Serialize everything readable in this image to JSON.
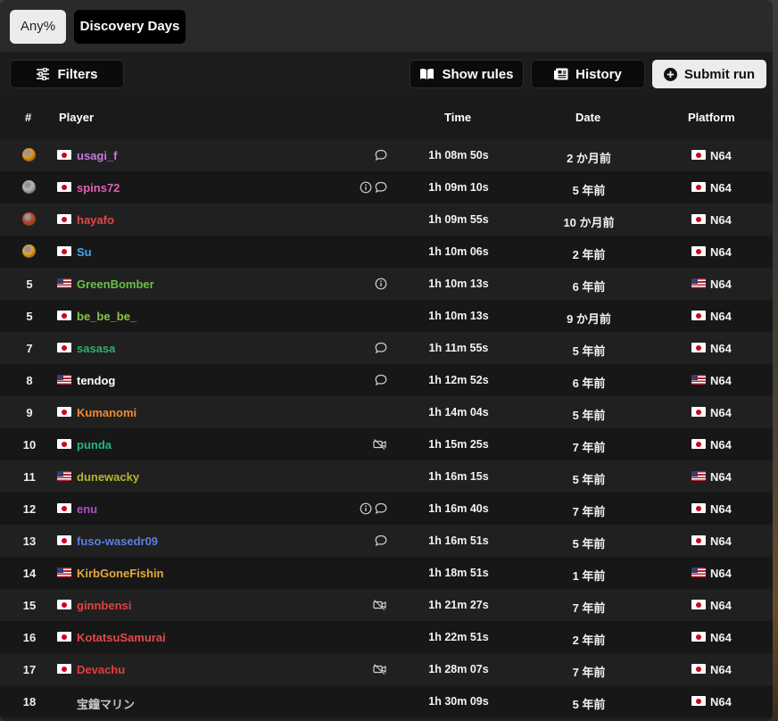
{
  "category_tabs": {
    "any_label": "Any%",
    "discovery_label": "Discovery Days"
  },
  "toolbar": {
    "filters_label": "Filters",
    "rules_label": "Show rules",
    "history_label": "History",
    "submit_label": "Submit run"
  },
  "table": {
    "headers": {
      "rank": "#",
      "player": "Player",
      "time": "Time",
      "date": "Date",
      "platform": "Platform"
    },
    "rows": [
      {
        "rank": "",
        "medal": "gold-trophy",
        "player_flag": "jp",
        "player": "usagi_f",
        "player_color": "#c678dd",
        "icons": [
          "comment"
        ],
        "time": "1h 08m 50s",
        "date": "2 か月前",
        "platform_flag": "jp",
        "platform": "N64"
      },
      {
        "rank": "",
        "medal": "silver-trophy",
        "player_flag": "jp",
        "player": "spins72",
        "player_color": "#e060b0",
        "icons": [
          "info",
          "comment"
        ],
        "time": "1h 09m 10s",
        "date": "5 年前",
        "platform_flag": "jp",
        "platform": "N64"
      },
      {
        "rank": "",
        "medal": "bronze-trophy",
        "player_flag": "jp",
        "player": "hayafo",
        "player_color": "#e04848",
        "icons": [],
        "time": "1h 09m 55s",
        "date": "10 か月前",
        "platform_flag": "jp",
        "platform": "N64"
      },
      {
        "rank": "",
        "medal": "fourth-trophy",
        "player_flag": "jp",
        "player": "Su",
        "player_color": "#4aa3e8",
        "icons": [],
        "time": "1h 10m 06s",
        "date": "2 年前",
        "platform_flag": "jp",
        "platform": "N64"
      },
      {
        "rank": "5",
        "medal": "",
        "player_flag": "us",
        "player": "GreenBomber",
        "player_color": "#6abf4b",
        "icons": [
          "info"
        ],
        "time": "1h 10m 13s",
        "date": "6 年前",
        "platform_flag": "us",
        "platform": "N64"
      },
      {
        "rank": "5",
        "medal": "",
        "player_flag": "jp",
        "player": "be_be_be_",
        "player_color": "#8bc34a",
        "icons": [],
        "time": "1h 10m 13s",
        "date": "9 か月前",
        "platform_flag": "jp",
        "platform": "N64"
      },
      {
        "rank": "7",
        "medal": "",
        "player_flag": "jp",
        "player": "sasasa",
        "player_color": "#28b463",
        "icons": [
          "comment"
        ],
        "time": "1h 11m 55s",
        "date": "5 年前",
        "platform_flag": "jp",
        "platform": "N64"
      },
      {
        "rank": "8",
        "medal": "",
        "player_flag": "us",
        "player": "tendog",
        "player_color": "#ffffff",
        "icons": [
          "comment"
        ],
        "time": "1h 12m 52s",
        "date": "6 年前",
        "platform_flag": "us",
        "platform": "N64"
      },
      {
        "rank": "9",
        "medal": "",
        "player_flag": "jp",
        "player": "Kumanomi",
        "player_color": "#f08a30",
        "icons": [],
        "time": "1h 14m 04s",
        "date": "5 年前",
        "platform_flag": "jp",
        "platform": "N64"
      },
      {
        "rank": "10",
        "medal": "",
        "player_flag": "jp",
        "player": "punda",
        "player_color": "#1fb87a",
        "icons": [
          "no-video"
        ],
        "time": "1h 15m 25s",
        "date": "7 年前",
        "platform_flag": "jp",
        "platform": "N64"
      },
      {
        "rank": "11",
        "medal": "",
        "player_flag": "us",
        "player": "dunewacky",
        "player_color": "#b5b531",
        "icons": [],
        "time": "1h 16m 15s",
        "date": "5 年前",
        "platform_flag": "us",
        "platform": "N64"
      },
      {
        "rank": "12",
        "medal": "",
        "player_flag": "jp",
        "player": "enu",
        "player_color": "#b04ccf",
        "icons": [
          "info",
          "comment"
        ],
        "time": "1h 16m 40s",
        "date": "7 年前",
        "platform_flag": "jp",
        "platform": "N64"
      },
      {
        "rank": "13",
        "medal": "",
        "player_flag": "jp",
        "player": "fuso-wasedr09",
        "player_color": "#5b7fe0",
        "icons": [
          "comment"
        ],
        "time": "1h 16m 51s",
        "date": "5 年前",
        "platform_flag": "jp",
        "platform": "N64"
      },
      {
        "rank": "14",
        "medal": "",
        "player_flag": "us",
        "player": "KirbGoneFishin",
        "player_color": "#e8a838",
        "icons": [],
        "time": "1h 18m 51s",
        "date": "1 年前",
        "platform_flag": "us",
        "platform": "N64"
      },
      {
        "rank": "15",
        "medal": "",
        "player_flag": "jp",
        "player": "ginnbensi",
        "player_color": "#e0443c",
        "icons": [
          "no-video"
        ],
        "time": "1h 21m 27s",
        "date": "7 年前",
        "platform_flag": "jp",
        "platform": "N64"
      },
      {
        "rank": "16",
        "medal": "",
        "player_flag": "jp",
        "player": "KotatsuSamurai",
        "player_color": "#e8464a",
        "icons": [],
        "time": "1h 22m 51s",
        "date": "2 年前",
        "platform_flag": "jp",
        "platform": "N64"
      },
      {
        "rank": "17",
        "medal": "",
        "player_flag": "jp",
        "player": "Devachu",
        "player_color": "#e83c3c",
        "icons": [
          "no-video"
        ],
        "time": "1h 28m 07s",
        "date": "7 年前",
        "platform_flag": "jp",
        "platform": "N64"
      },
      {
        "rank": "18",
        "medal": "",
        "player_flag": "",
        "player": "宝鐘マリン",
        "player_color": "#c8c8c8",
        "icons": [],
        "time": "1h 30m 09s",
        "date": "5 年前",
        "platform_flag": "jp",
        "platform": "N64"
      }
    ]
  },
  "colors": {
    "panel": "#1f1f1f",
    "gold": "#e39b1a",
    "silver": "#b8b8b8",
    "bronze": "#c0482a",
    "fourth": "#e3a52a"
  }
}
